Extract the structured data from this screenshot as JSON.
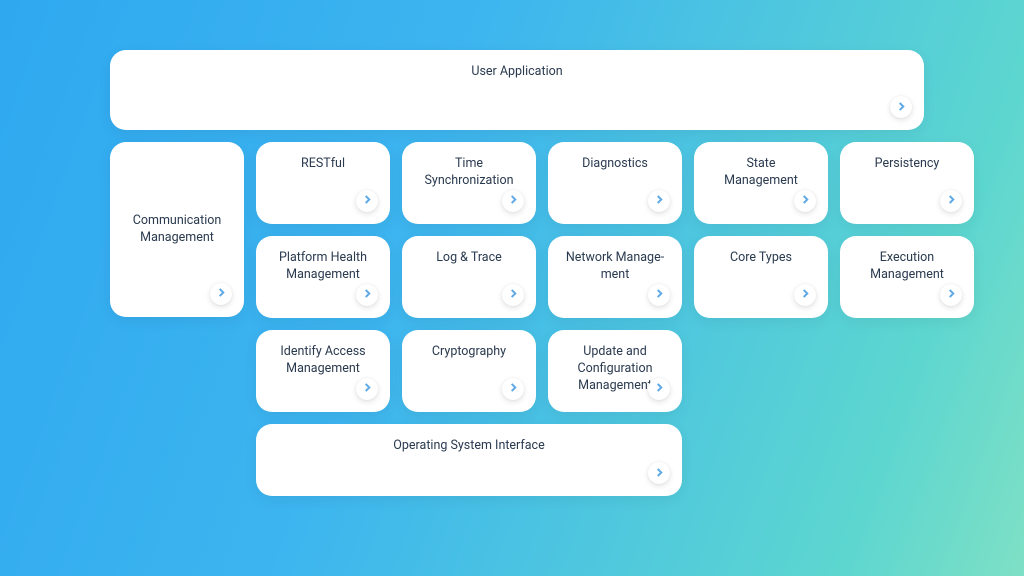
{
  "top": {
    "label": "User Application"
  },
  "left": {
    "label": "Communication Management"
  },
  "grid": {
    "row1": [
      {
        "label": "RESTful"
      },
      {
        "label": "Time Synchroniza­tion"
      },
      {
        "label": "Diagnostics"
      },
      {
        "label": "State Management"
      },
      {
        "label": "Persistency"
      }
    ],
    "row2": [
      {
        "label": "Platform Health Management"
      },
      {
        "label": "Log & Trace"
      },
      {
        "label": "Network Manage­ment"
      },
      {
        "label": "Core Types"
      },
      {
        "label": "Execution Manage­ment"
      }
    ],
    "row3": [
      {
        "label": "Identify Access Management"
      },
      {
        "label": "Cryptography"
      },
      {
        "label": "Update and Configu­ration Management"
      }
    ]
  },
  "bottom": {
    "label": "Operating System Interface"
  }
}
